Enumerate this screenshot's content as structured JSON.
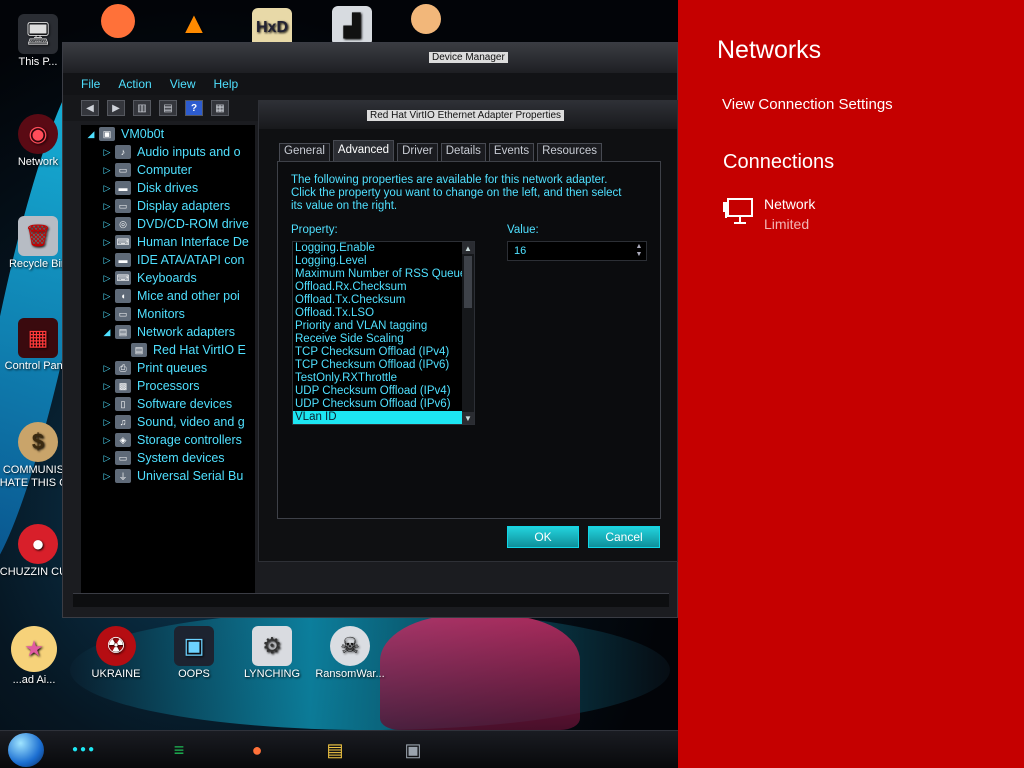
{
  "desktop": {
    "icons": [
      {
        "label": "This P...",
        "glyph": "🖥"
      },
      {
        "label": "Network",
        "glyph": "◉"
      },
      {
        "label": "Recycle Bin",
        "glyph": "🗑"
      },
      {
        "label": "Control Panel",
        "glyph": "▦"
      },
      {
        "label": "COMMUNIS... HATE THIS C...",
        "glyph": "$"
      },
      {
        "label": "CHUZZIN CUM",
        "glyph": "●"
      },
      {
        "label": "UKRAINE",
        "glyph": "☢"
      },
      {
        "label": "OOPS",
        "glyph": "▣"
      },
      {
        "label": "LYNCHING",
        "glyph": "⚙"
      },
      {
        "label": "RansomWar...",
        "glyph": "☠"
      },
      {
        "label": "...ad Ai...",
        "glyph": "★"
      }
    ],
    "top_icons": [
      "firefox",
      "vlc",
      "hxd",
      "app",
      "person"
    ]
  },
  "device_manager": {
    "title": "Device Manager",
    "menu": [
      "File",
      "Action",
      "View",
      "Help"
    ],
    "tree": [
      {
        "label": "VM0b0t",
        "expander": "◢",
        "icon": "▣",
        "indent": 0
      },
      {
        "label": "Audio inputs and o",
        "expander": "▷",
        "icon": "♪",
        "indent": 1
      },
      {
        "label": "Computer",
        "expander": "▷",
        "icon": "▭",
        "indent": 1
      },
      {
        "label": "Disk drives",
        "expander": "▷",
        "icon": "▬",
        "indent": 1
      },
      {
        "label": "Display adapters",
        "expander": "▷",
        "icon": "▭",
        "indent": 1
      },
      {
        "label": "DVD/CD-ROM drive",
        "expander": "▷",
        "icon": "◎",
        "indent": 1
      },
      {
        "label": "Human Interface De",
        "expander": "▷",
        "icon": "⌨",
        "indent": 1
      },
      {
        "label": "IDE ATA/ATAPI con",
        "expander": "▷",
        "icon": "▬",
        "indent": 1
      },
      {
        "label": "Keyboards",
        "expander": "▷",
        "icon": "⌨",
        "indent": 1
      },
      {
        "label": "Mice and other poi",
        "expander": "▷",
        "icon": "◖",
        "indent": 1
      },
      {
        "label": "Monitors",
        "expander": "▷",
        "icon": "▭",
        "indent": 1
      },
      {
        "label": "Network adapters",
        "expander": "◢",
        "icon": "▤",
        "indent": 1
      },
      {
        "label": "Red Hat VirtIO E",
        "expander": "",
        "icon": "▤",
        "indent": 2
      },
      {
        "label": "Print queues",
        "expander": "▷",
        "icon": "⎙",
        "indent": 1
      },
      {
        "label": "Processors",
        "expander": "▷",
        "icon": "▩",
        "indent": 1
      },
      {
        "label": "Software devices",
        "expander": "▷",
        "icon": "▯",
        "indent": 1
      },
      {
        "label": "Sound, video and g",
        "expander": "▷",
        "icon": "♫",
        "indent": 1
      },
      {
        "label": "Storage controllers",
        "expander": "▷",
        "icon": "◈",
        "indent": 1
      },
      {
        "label": "System devices",
        "expander": "▷",
        "icon": "▭",
        "indent": 1
      },
      {
        "label": "Universal Serial Bu",
        "expander": "▷",
        "icon": "⏚",
        "indent": 1
      }
    ]
  },
  "properties": {
    "title": "Red Hat VirtIO Ethernet Adapter Properties",
    "tabs": [
      "General",
      "Advanced",
      "Driver",
      "Details",
      "Events",
      "Resources"
    ],
    "active_tab": "Advanced",
    "intro": "The following properties are available for this network adapter. Click the property you want to change on the left, and then select its value on the right.",
    "property_label": "Property:",
    "value_label": "Value:",
    "properties": [
      "Logging.Enable",
      "Logging.Level",
      "Maximum Number of RSS Queues",
      "Offload.Rx.Checksum",
      "Offload.Tx.Checksum",
      "Offload.Tx.LSO",
      "Priority and VLAN tagging",
      "Receive Side Scaling",
      "TCP Checksum Offload (IPv4)",
      "TCP Checksum Offload (IPv6)",
      "TestOnly.RXThrottle",
      "UDP Checksum Offload (IPv4)",
      "UDP Checksum Offload (IPv6)",
      "VLan ID"
    ],
    "selected_property": "VLan ID",
    "value": "16",
    "ok_label": "OK",
    "cancel_label": "Cancel"
  },
  "flyout": {
    "title": "Networks",
    "settings_link": "View Connection Settings",
    "connections_heading": "Connections",
    "network_name": "Network",
    "network_status": "Limited",
    "bg_color": "#c50000"
  },
  "taskbar": {
    "apps": [
      {
        "name": "spotify",
        "glyph": "≡",
        "color": "#1db954"
      },
      {
        "name": "firefox",
        "glyph": "●",
        "color": "#ff7139"
      },
      {
        "name": "file-explorer",
        "glyph": "▤",
        "color": "#f2c744"
      },
      {
        "name": "device-manager",
        "glyph": "▣",
        "color": "#9aa3ad"
      }
    ]
  }
}
